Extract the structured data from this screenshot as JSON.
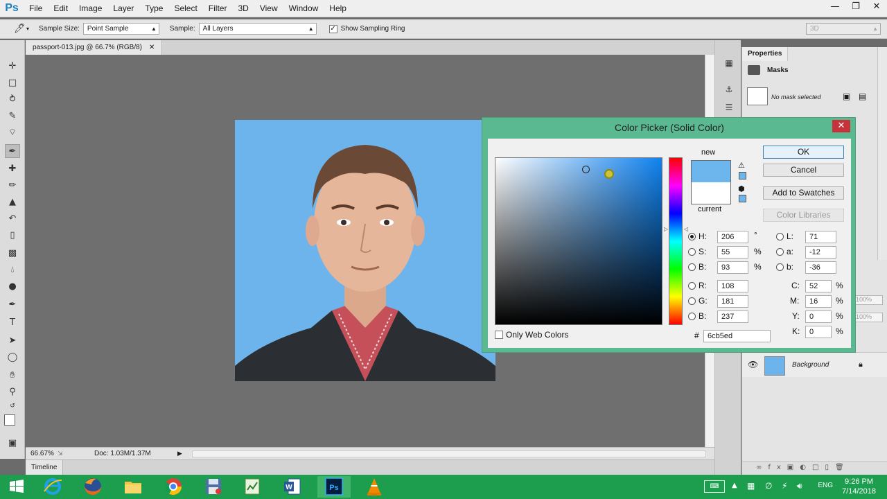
{
  "app": {
    "logo": "Ps",
    "menu": [
      "File",
      "Edit",
      "Image",
      "Layer",
      "Type",
      "Select",
      "Filter",
      "3D",
      "View",
      "Window",
      "Help"
    ],
    "window_controls": {
      "minimize": "—",
      "restore": "❐",
      "close": "✕"
    }
  },
  "options_bar": {
    "sample_size_label": "Sample Size:",
    "sample_size_value": "Point Sample",
    "sample_label": "Sample:",
    "sample_value": "All Layers",
    "show_ring_label": "Show Sampling Ring",
    "show_ring_checked": true,
    "workspace": "3D"
  },
  "document": {
    "tab_title": "passport-013.jpg @ 66.7% (RGB/8)",
    "zoom": "66.67%",
    "doc_info": "Doc: 1.03M/1.37M",
    "timeline_label": "Timeline"
  },
  "properties": {
    "tab": "Properties",
    "section": "Masks",
    "mask_status": "No mask selected"
  },
  "layers": {
    "opacity": "100%",
    "fill": "100%",
    "layer_name": "Background"
  },
  "color_picker": {
    "title": "Color Picker (Solid Color)",
    "new_label": "new",
    "current_label": "current",
    "new_color": "#6cb5ed",
    "current_color": "#ffffff",
    "ok": "OK",
    "cancel": "Cancel",
    "add_to_swatches": "Add to Swatches",
    "color_libraries": "Color Libraries",
    "hsb": {
      "H": "206",
      "S": "55",
      "B": "93"
    },
    "rgb": {
      "R": "108",
      "G": "181",
      "B": "237"
    },
    "lab": {
      "L": "71",
      "a": "-12",
      "b": "-36"
    },
    "cmyk": {
      "C": "52",
      "M": "16",
      "Y": "0",
      "K": "0"
    },
    "hex": "6cb5ed",
    "hex_label": "#",
    "only_web_colors": "Only Web Colors",
    "selected_mode": "H",
    "units": {
      "deg": "°",
      "pct": "%"
    }
  },
  "taskbar": {
    "language": "ENG",
    "time": "9:26 PM",
    "date": "7/14/2018"
  }
}
